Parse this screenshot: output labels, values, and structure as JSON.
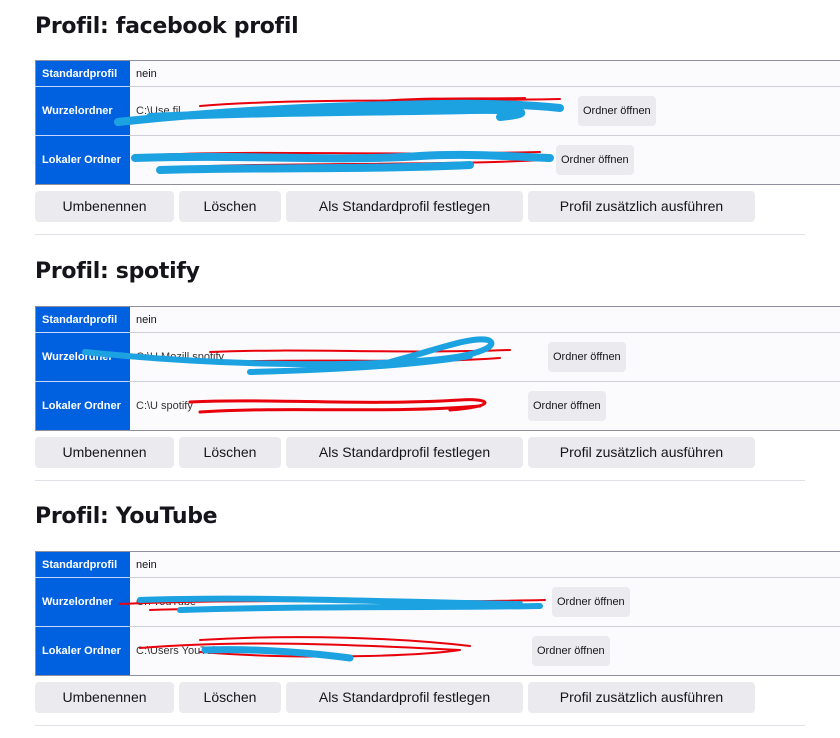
{
  "labels": {
    "standard_profile": "Standardprofil",
    "root_folder": "Wurzelordner",
    "local_folder": "Lokaler Ordner",
    "open_folder": "Ordner öffnen",
    "rename": "Umbenennen",
    "delete": "Löschen",
    "set_default": "Als Standardprofil festlegen",
    "run_additionally": "Profil zusätzlich ausführen"
  },
  "profiles": [
    {
      "title": "Profil: facebook profil",
      "standard_value": "nein",
      "root_path": "C:\\Use                                                              fil",
      "local_path": ""
    },
    {
      "title": "Profil: spotify",
      "standard_value": "nein",
      "root_path": "C:\\U              Mozill                    spotify",
      "local_path": "C:\\U                                          spotify"
    },
    {
      "title": "Profil: YouTube",
      "standard_value": "nein",
      "root_path": "C:\\                                        YouTube",
      "local_path": "C:\\Users                                     YouTube"
    }
  ],
  "colors": {
    "header_blue": "#0061e0",
    "redaction_red": "#e8000b",
    "redaction_blue": "#1ca2e0",
    "button_bg": "#ebebef"
  }
}
